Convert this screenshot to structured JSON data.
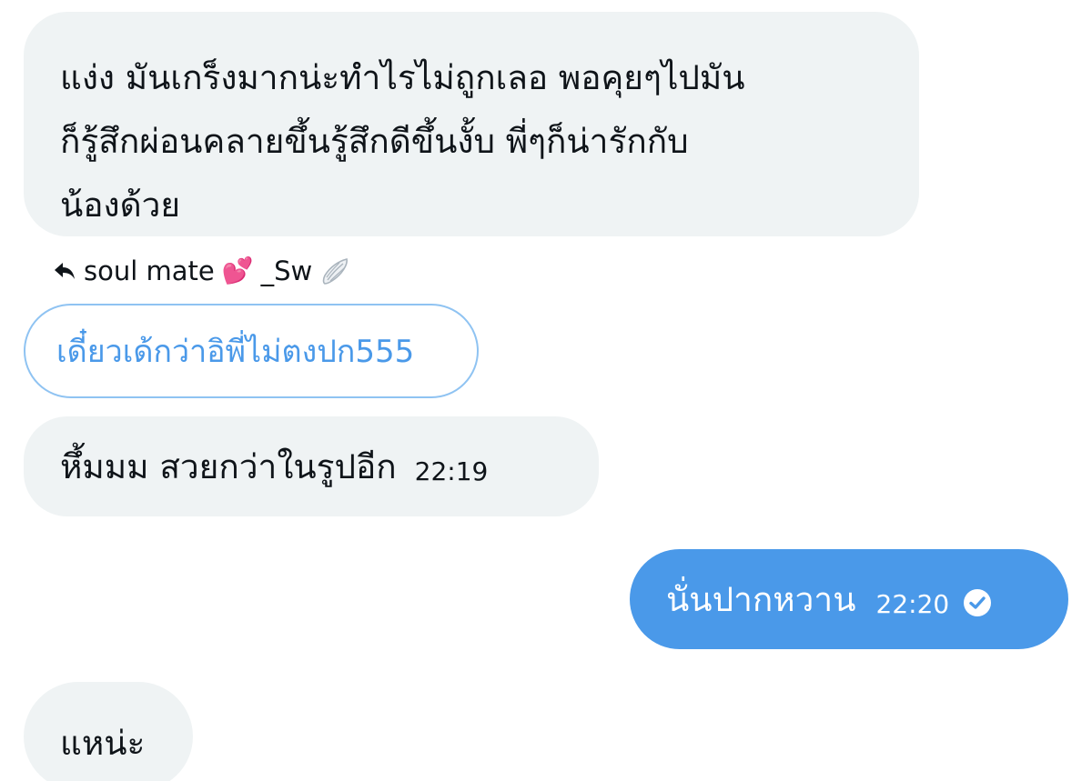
{
  "messages": [
    {
      "id": "msg1",
      "direction": "incoming",
      "lines": [
        "แง่ง มันเกร็งมากน่ะทำไรไม่ถูกเลอ พอคุยๆไปมัน",
        "ก็รู้สึกผ่อนคลายขึ้นรู้สึกดีขึ้นงั้บ พี่ๆก็น่ารักกับ",
        "น้องด้วย"
      ]
    },
    {
      "id": "msg2",
      "direction": "incoming",
      "reply_to": {
        "author": "soul mate",
        "author_suffix": "_Sw",
        "emoji": "💕",
        "wing_icon": "wing-icon",
        "quoted_text": "เดี๋ยวเด้กว่าอิพี่ไม่ตงปก555"
      },
      "text": "หึ้มมม สวยกว่าในรูปอีก",
      "time": "22:19"
    },
    {
      "id": "msg3",
      "direction": "outgoing",
      "text": "นั่นปากหวาน",
      "time": "22:20",
      "status_icon": "check-circle-icon"
    },
    {
      "id": "msg4",
      "direction": "incoming",
      "text": "แหน่ะ"
    }
  ],
  "colors": {
    "incoming_bg": "#eff3f4",
    "outgoing_bg": "#4a99e9",
    "quote_border": "#8fc3f2",
    "quote_text": "#4a99e9",
    "text": "#0f1419"
  }
}
